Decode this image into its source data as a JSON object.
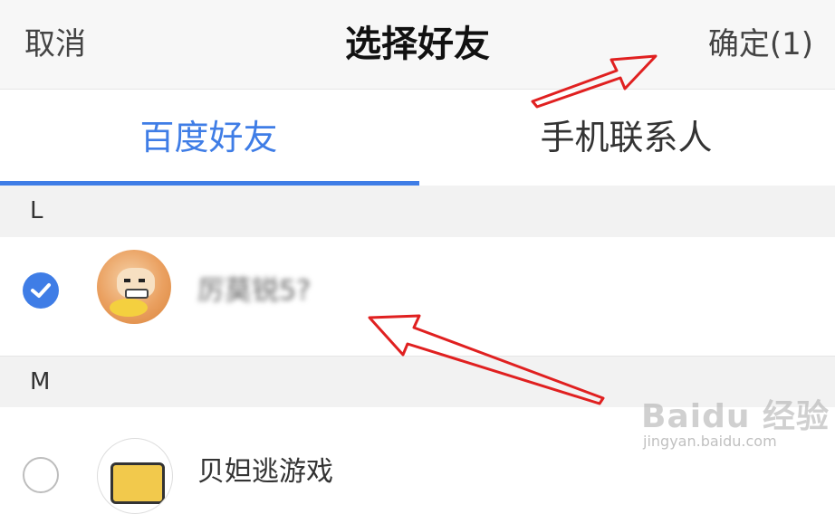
{
  "header": {
    "cancel_label": "取消",
    "title": "选择好友",
    "confirm_label": "确定(1)"
  },
  "tabs": [
    {
      "label": "百度好友",
      "active": true
    },
    {
      "label": "手机联系人",
      "active": false
    }
  ],
  "sections": [
    {
      "letter": "L",
      "items": [
        {
          "name": "厉莫锐5?",
          "checked": true,
          "avatar": "cartoon-face-avatar"
        }
      ]
    },
    {
      "letter": "M",
      "items": [
        {
          "name": "贝妲逃游戏",
          "checked": false,
          "avatar": "tv-avatar"
        }
      ]
    }
  ],
  "watermark": {
    "logo": "Baidu 经验",
    "url": "jingyan.baidu.com"
  },
  "colors": {
    "accent": "#3f7de6",
    "annotation_arrow": "#e02020"
  }
}
